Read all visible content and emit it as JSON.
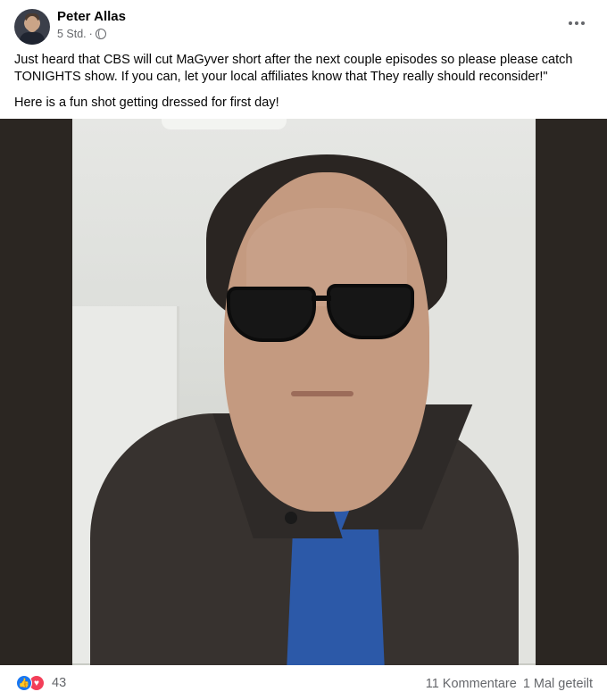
{
  "post": {
    "author": "Peter Allas",
    "time": "5 Std.",
    "separator": "·",
    "paragraphs": [
      "Just heard that CBS will cut MaGyver short after the next couple episodes so please please catch TONIGHTS show. If you can, let your local affiliates know that They really should reconsider!\"",
      "Here is a fun shot getting dressed for first day!"
    ]
  },
  "icons": {
    "avatar": "avatar",
    "audience": "globe-icon",
    "more": "more-options-icon",
    "like": "like-icon",
    "love": "love-icon",
    "like_glyph": "👍",
    "love_glyph": "♥"
  },
  "footer": {
    "reaction_count": "43",
    "comments": "11 Kommentare",
    "shares": "1 Mal geteilt"
  },
  "colors": {
    "like": "#1877f2",
    "love": "#f33e58",
    "secondary_text": "#65676b"
  }
}
